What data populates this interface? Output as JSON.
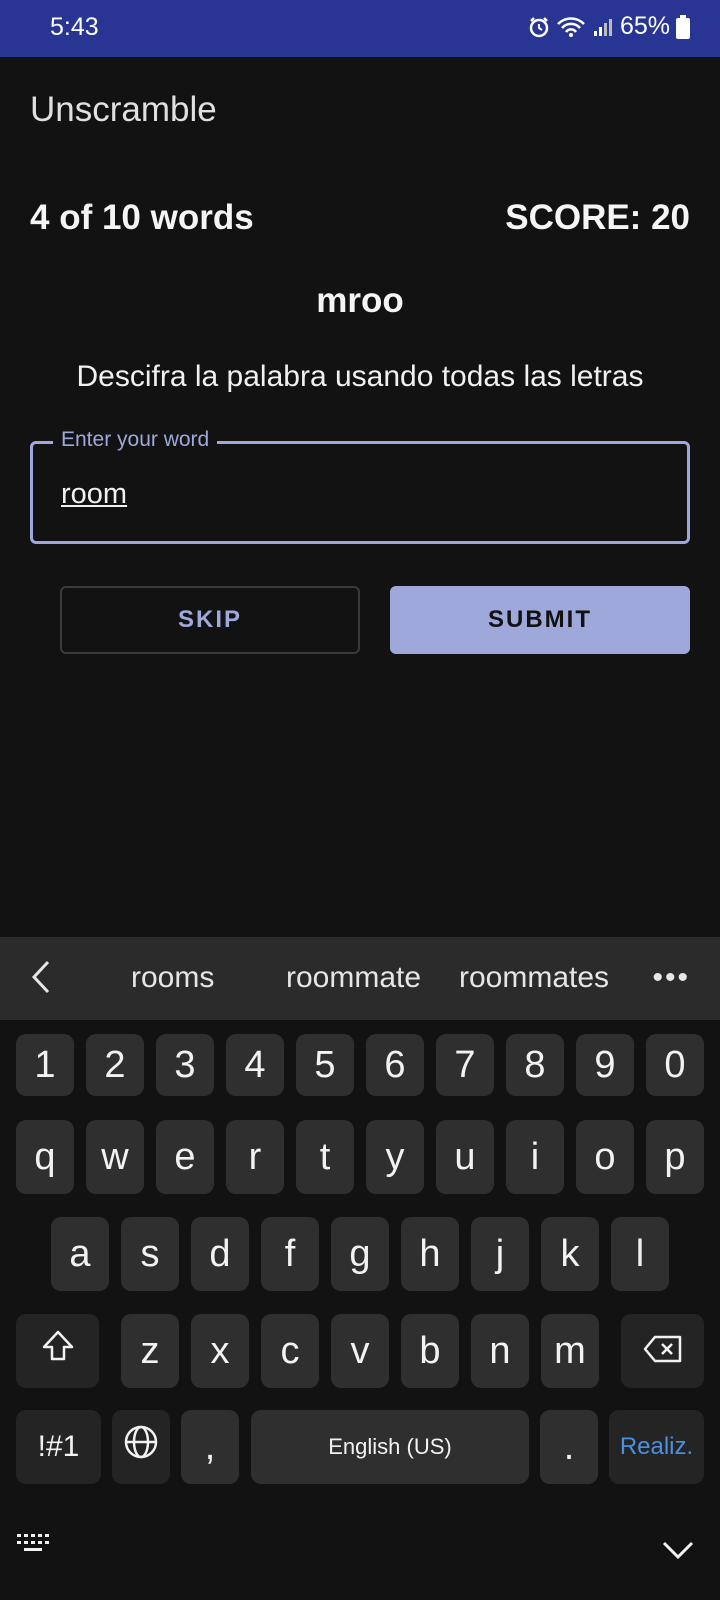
{
  "status_bar": {
    "time": "5:43",
    "battery": "65%"
  },
  "app": {
    "title": "Unscramble"
  },
  "game": {
    "word_count": "4 of 10 words",
    "score": "SCORE: 20",
    "scrambled_word": "mroo",
    "instructions": "Descifra la palabra usando todas las letras"
  },
  "input": {
    "label": "Enter your word",
    "value": "room"
  },
  "buttons": {
    "skip": "SKIP",
    "submit": "SUBMIT"
  },
  "keyboard": {
    "suggestions": [
      "rooms",
      "roommate",
      "roommates"
    ],
    "more": "•••",
    "numbers": [
      "1",
      "2",
      "3",
      "4",
      "5",
      "6",
      "7",
      "8",
      "9",
      "0"
    ],
    "row1": [
      "q",
      "w",
      "e",
      "r",
      "t",
      "y",
      "u",
      "i",
      "o",
      "p"
    ],
    "row2": [
      "a",
      "s",
      "d",
      "f",
      "g",
      "h",
      "j",
      "k",
      "l"
    ],
    "row3": [
      "z",
      "x",
      "c",
      "v",
      "b",
      "n",
      "m"
    ],
    "symbols": "!#1",
    "comma": ",",
    "space": "English (US)",
    "period": ".",
    "action": "Realiz."
  },
  "colors": {
    "status_bar": "#283593",
    "accent": "#9fa8da",
    "background": "#121212"
  }
}
